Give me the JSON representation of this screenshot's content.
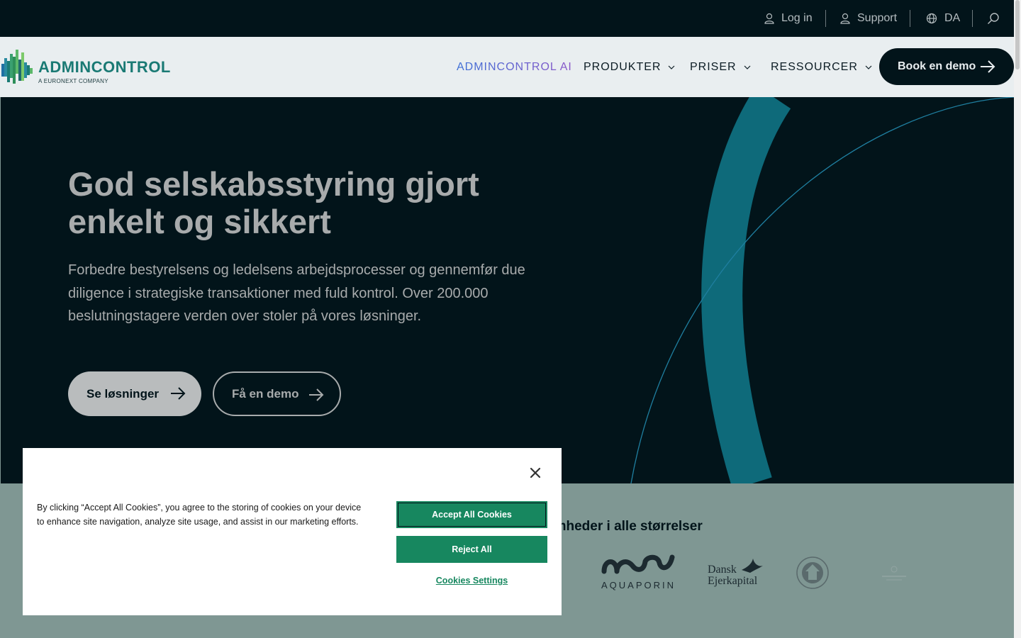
{
  "topbar": {
    "login_label": "Log in",
    "support_label": "Support",
    "language_label": "DA"
  },
  "header": {
    "logo_word": "ADMINCONTROL",
    "logo_sub": "A EURONEXT COMPANY",
    "nav": [
      {
        "label": "ADMINCONTROL AI"
      },
      {
        "label": "PRODUKTER"
      },
      {
        "label": "PRISER"
      },
      {
        "label": "RESSOURCER"
      }
    ],
    "cta_label": "Book en demo"
  },
  "hero": {
    "title": "God selskabsstyring gjort enkelt og sikkert",
    "text": "Forbedre bestyrelsens og ledelsens arbejdsprocesser og gennemfør due diligence i strategiske transaktioner med fuld kontrol. Over 200.000 beslutningstagere verden over stoler på vores løsninger.",
    "primary_label": "Se løsninger",
    "secondary_label": "Få en demo"
  },
  "clients": {
    "title_fragment": "omheder i alle størrelser",
    "logos": [
      {
        "name": "aquaporin-logo",
        "text": "AQUAPORIN"
      },
      {
        "name": "dansk-ejerkapital-logo",
        "line1": "Dansk",
        "line2": "Ejerkapital"
      },
      {
        "name": "seal-logo"
      },
      {
        "name": "faint-logo"
      }
    ]
  },
  "cookie": {
    "text": "By clicking “Accept All Cookies”, you agree to the storing of cookies on your device to enhance site navigation, analyze site usage, and assist in our marketing efforts.",
    "accept_label": "Accept All Cookies",
    "reject_label": "Reject All",
    "settings_label": "Cookies Settings"
  },
  "colors": {
    "dark": "#02141a",
    "header_bg": "#e9eef0",
    "teal": "#1a7a74",
    "cookie_green": "#17875f",
    "band": "#7f9793"
  }
}
